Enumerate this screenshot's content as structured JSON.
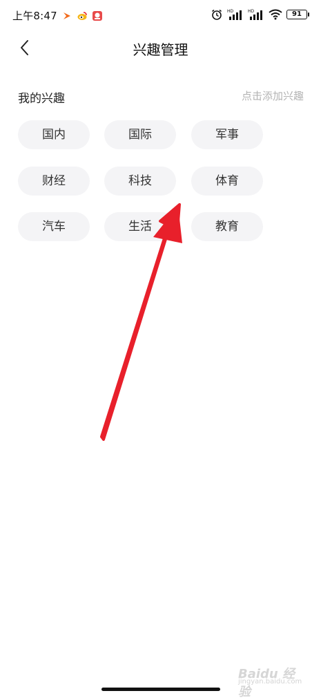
{
  "status_bar": {
    "time": "上午8:47",
    "battery": "91",
    "signal_label_1": "HD",
    "signal_label_2": "HD"
  },
  "nav": {
    "title": "兴趣管理"
  },
  "section": {
    "title": "我的兴趣",
    "add_label": "点击添加兴趣"
  },
  "tags": [
    "国内",
    "国际",
    "军事",
    "财经",
    "科技",
    "体育",
    "汽车",
    "生活",
    "教育"
  ],
  "watermark": {
    "brand": "Baidu 经验",
    "url": "jingyan.baidu.com"
  },
  "colors": {
    "annotation_arrow": "#e8202b",
    "tag_bg": "#f4f4f6",
    "muted_text": "#b3b3b3"
  }
}
